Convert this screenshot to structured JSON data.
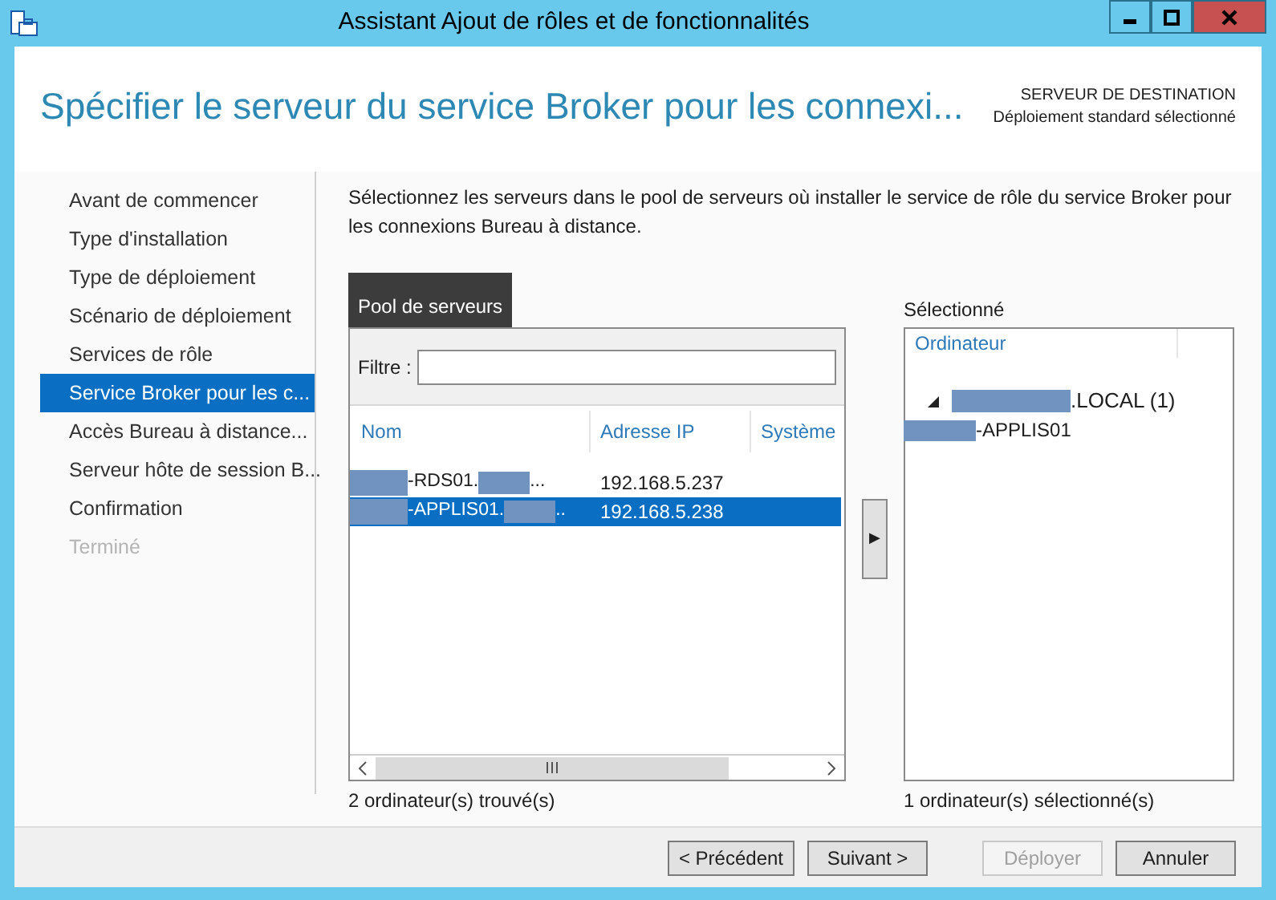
{
  "window": {
    "title": "Assistant Ajout de rôles et de fonctionnalités",
    "controls": [
      {
        "kind": "minimize"
      },
      {
        "kind": "maximize"
      },
      {
        "kind": "close"
      }
    ]
  },
  "header": {
    "title": "Spécifier le serveur du service Broker pour les connexi...",
    "destination_label": "SERVEUR DE DESTINATION",
    "destination_value": "Déploiement standard sélectionné"
  },
  "steps": [
    {
      "label": "Avant de commencer",
      "selected": false,
      "disabled": false
    },
    {
      "label": "Type d'installation",
      "selected": false,
      "disabled": false
    },
    {
      "label": "Type de déploiement",
      "selected": false,
      "disabled": false
    },
    {
      "label": "Scénario de déploiement",
      "selected": false,
      "disabled": false
    },
    {
      "label": "Services de rôle",
      "selected": false,
      "disabled": false
    },
    {
      "label": "Service Broker pour les c...",
      "selected": true,
      "disabled": false
    },
    {
      "label": "Accès Bureau à distance...",
      "selected": false,
      "disabled": false
    },
    {
      "label": "Serveur hôte de session B...",
      "selected": false,
      "disabled": false
    },
    {
      "label": "Confirmation",
      "selected": false,
      "disabled": false
    },
    {
      "label": "Terminé",
      "selected": false,
      "disabled": true
    }
  ],
  "description": "Sélectionnez les serveurs dans le pool de serveurs où installer le service de rôle du service Broker pour les connexions Bureau à distance.",
  "pool": {
    "tab": "Pool de serveurs",
    "filter_label": "Filtre :",
    "columns": [
      "Nom",
      "Adresse IP",
      "Système"
    ],
    "rows": [
      {
        "name": "-RDS01.",
        "name_end": "...",
        "ip": "192.168.5.237",
        "selected": false
      },
      {
        "name": "-APPLIS01.",
        "name_end": "..",
        "ip": "192.168.5.238",
        "selected": true
      }
    ],
    "status": "2 ordinateur(s) trouvé(s)"
  },
  "move_button": "▶",
  "selected_panel": {
    "label": "Sélectionné",
    "column": "Ordinateur",
    "tree": [
      {
        "label": ".LOCAL (1)",
        "expanded": true,
        "children": [
          {
            "label": "-APPLIS01"
          }
        ]
      }
    ],
    "status": "1 ordinateur(s) sélectionné(s)"
  },
  "buttons": [
    {
      "label": "< Précédent",
      "disabled": false
    },
    {
      "label": "Suivant >",
      "disabled": false
    },
    {
      "label": "Déployer",
      "disabled": true
    },
    {
      "label": "Annuler",
      "disabled": false
    }
  ]
}
